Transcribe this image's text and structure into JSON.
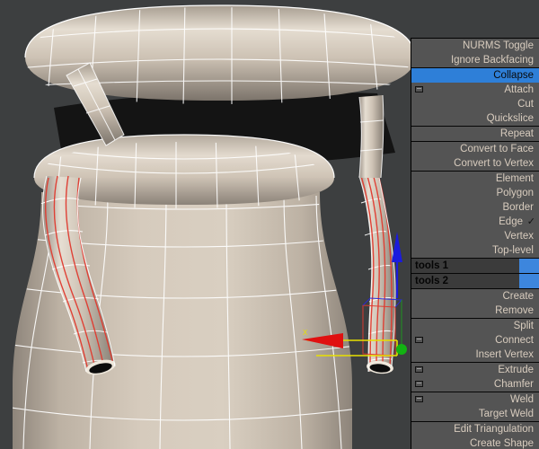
{
  "app": {
    "kind": "3d-modeling-viewport-quad-menu",
    "viewport_background": "#3d3f40",
    "model_color": "#cfc4b6",
    "wireframe_color": "#ffffff",
    "selected_edge_color": "#e03a2f"
  },
  "gizmo": {
    "x_axis_color": "#e01010",
    "z_axis_color": "#1b1bdd",
    "plane_handle_color": "#e8e000",
    "center_color": "#12b312",
    "x_label": "X"
  },
  "menu": {
    "background": "#545454",
    "text_color": "#d8ccbe",
    "highlight_color": "#2e7fd8",
    "swatch_color": "#3d86dd",
    "check_glyph": "✓",
    "groups": [
      {
        "name": "group-toggle",
        "items": [
          {
            "label": "NURMS Toggle",
            "dialog_icon": false,
            "checked": false,
            "highlighted": false
          },
          {
            "label": "Ignore Backfacing",
            "dialog_icon": false,
            "checked": false,
            "highlighted": false
          }
        ]
      },
      {
        "name": "group-edit",
        "items": [
          {
            "label": "Collapse",
            "dialog_icon": false,
            "checked": false,
            "highlighted": true
          },
          {
            "label": "Attach",
            "dialog_icon": true,
            "checked": false,
            "highlighted": false
          },
          {
            "label": "Cut",
            "dialog_icon": false,
            "checked": false,
            "highlighted": false
          },
          {
            "label": "Quickslice",
            "dialog_icon": false,
            "checked": false,
            "highlighted": false
          }
        ]
      },
      {
        "name": "group-repeat",
        "items": [
          {
            "label": "Repeat",
            "dialog_icon": false,
            "checked": false,
            "highlighted": false
          }
        ]
      },
      {
        "name": "group-convert",
        "items": [
          {
            "label": "Convert to Face",
            "dialog_icon": false,
            "checked": false,
            "highlighted": false
          },
          {
            "label": "Convert to Vertex",
            "dialog_icon": false,
            "checked": false,
            "highlighted": false
          }
        ]
      },
      {
        "name": "group-subobject-level",
        "items": [
          {
            "label": "Element",
            "dialog_icon": false,
            "checked": false,
            "highlighted": false
          },
          {
            "label": "Polygon",
            "dialog_icon": false,
            "checked": false,
            "highlighted": false
          },
          {
            "label": "Border",
            "dialog_icon": false,
            "checked": false,
            "highlighted": false
          },
          {
            "label": "Edge",
            "dialog_icon": false,
            "checked": true,
            "highlighted": false
          },
          {
            "label": "Vertex",
            "dialog_icon": false,
            "checked": false,
            "highlighted": false
          },
          {
            "label": "Top-level",
            "dialog_icon": false,
            "checked": false,
            "highlighted": false
          }
        ]
      }
    ],
    "tools_headers": [
      {
        "label": "tools 1"
      },
      {
        "label": "tools 2"
      }
    ],
    "groups_lower": [
      {
        "name": "group-create-remove",
        "items": [
          {
            "label": "Create",
            "dialog_icon": false,
            "checked": false,
            "highlighted": false
          },
          {
            "label": "Remove",
            "dialog_icon": false,
            "checked": false,
            "highlighted": false
          }
        ]
      },
      {
        "name": "group-split",
        "items": [
          {
            "label": "Split",
            "dialog_icon": false,
            "checked": false,
            "highlighted": false
          },
          {
            "label": "Connect",
            "dialog_icon": true,
            "checked": false,
            "highlighted": false
          },
          {
            "label": "Insert Vertex",
            "dialog_icon": false,
            "checked": false,
            "highlighted": false
          }
        ]
      },
      {
        "name": "group-extrude",
        "items": [
          {
            "label": "Extrude",
            "dialog_icon": true,
            "checked": false,
            "highlighted": false
          },
          {
            "label": "Chamfer",
            "dialog_icon": true,
            "checked": false,
            "highlighted": false
          }
        ]
      },
      {
        "name": "group-weld",
        "items": [
          {
            "label": "Weld",
            "dialog_icon": true,
            "checked": false,
            "highlighted": false
          },
          {
            "label": "Target Weld",
            "dialog_icon": false,
            "checked": false,
            "highlighted": false
          }
        ]
      },
      {
        "name": "group-misc",
        "items": [
          {
            "label": "Edit Triangulation",
            "dialog_icon": false,
            "checked": false,
            "highlighted": false
          },
          {
            "label": "Create Shape",
            "dialog_icon": false,
            "checked": false,
            "highlighted": false
          }
        ]
      }
    ]
  }
}
